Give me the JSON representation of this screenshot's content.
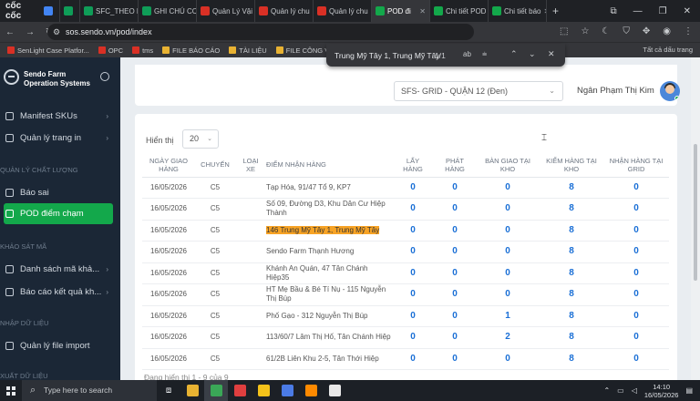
{
  "browser": {
    "brand": "cốc cốc",
    "tabs": [
      {
        "label": "",
        "color": "#4285f4",
        "active": false
      },
      {
        "label": "",
        "color": "#0f9d58",
        "active": false
      },
      {
        "label": "SFC_THEO D",
        "color": "#0f9d58",
        "active": false
      },
      {
        "label": "GHI CHÚ CC",
        "color": "#0f9d58",
        "active": false
      },
      {
        "label": "Quản Lý Vậi",
        "color": "#d93025",
        "active": false
      },
      {
        "label": "Quản lý chu",
        "color": "#d93025",
        "active": false
      },
      {
        "label": "Quản lý chu",
        "color": "#d93025",
        "active": false
      },
      {
        "label": "POD đi",
        "color": "#13a84b",
        "active": true
      },
      {
        "label": "Chi tiết POD",
        "color": "#13a84b",
        "active": false
      },
      {
        "label": "Chi tiết báo",
        "color": "#13a84b",
        "active": false
      }
    ],
    "url": "sos.sendo.vn/pod/index",
    "bookmarks": [
      "SenLight Case Platfor...",
      "OPC",
      "tms",
      "FILE BÁO CÁO",
      "TÀI LIỆU",
      "FILE CÔNG VIỆC"
    ],
    "bookmarks_right": "Tất cả dấu trang"
  },
  "find": {
    "query": "Trung Mỹ Tây 1, Trung Mỹ Tây",
    "count": "1/1",
    "ab": "ab"
  },
  "sidebar": {
    "title_line1": "Sendo Farm",
    "title_line2": "Operation Systems",
    "items": [
      {
        "label": "Manifest SKUs",
        "chev": "›"
      },
      {
        "label": "Quản lý trang in",
        "chev": "›"
      },
      {
        "label": "Báo sai",
        "chev": ""
      },
      {
        "label": "POD điểm chạm",
        "chev": ""
      },
      {
        "label": "Danh sách mã khả...",
        "chev": "›"
      },
      {
        "label": "Báo cáo kết quả kh...",
        "chev": "›"
      },
      {
        "label": "Quản lý file import",
        "chev": ""
      }
    ],
    "sections": [
      "QUẢN LÝ CHẤT LƯỢNG",
      "KHẢO SÁT MÃ",
      "NHẬP DỮ LIỆU",
      "XUẤT DỮ LIỆU"
    ]
  },
  "header": {
    "grid_select": "SFS- GRID - QUẬN 12 (Đen)",
    "user_name": "Ngân Phạm Thị Kim"
  },
  "table": {
    "show_label": "Hiển thị",
    "page_size": "20",
    "columns": [
      [
        "NGÀY GIAO",
        "HÀNG"
      ],
      [
        "CHUYẾN",
        ""
      ],
      [
        "LOẠI",
        "XE"
      ],
      [
        "ĐIỂM NHẬN HÀNG",
        ""
      ],
      [
        "LẤY",
        "HÀNG"
      ],
      [
        "PHÁT",
        "HÀNG"
      ],
      [
        "BÀN GIAO TẠI",
        "KHO"
      ],
      [
        "KIỂM HÀNG TẠI",
        "KHO"
      ],
      [
        "NHẬN HÀNG TẠI",
        "GRID"
      ]
    ],
    "rows": [
      {
        "date": "16/05/2026",
        "trip": "C5",
        "type": "",
        "place": "Tạp Hóa, 91/47 Tổ 9, KP7",
        "highlight": "",
        "pick": "0",
        "deliver": "0",
        "handover": "0",
        "check": "8",
        "receive": "0"
      },
      {
        "date": "16/05/2026",
        "trip": "C5",
        "type": "",
        "place": "Số 09, Đường D3, Khu Dân Cư Hiệp Thành",
        "highlight": "",
        "pick": "0",
        "deliver": "0",
        "handover": "0",
        "check": "8",
        "receive": "0"
      },
      {
        "date": "16/05/2026",
        "trip": "C5",
        "type": "",
        "place": "146 ",
        "highlight": "Trung Mỹ Tây 1, Trung Mỹ Tây",
        "pick": "0",
        "deliver": "0",
        "handover": "0",
        "check": "8",
        "receive": "0"
      },
      {
        "date": "16/05/2026",
        "trip": "C5",
        "type": "",
        "place": "Sendo Farm Thạnh Hương",
        "highlight": "",
        "pick": "0",
        "deliver": "0",
        "handover": "0",
        "check": "8",
        "receive": "0"
      },
      {
        "date": "16/05/2026",
        "trip": "C5",
        "type": "",
        "place": "Khánh An Quán, 47 Tân Chánh Hiệp35",
        "highlight": "",
        "pick": "0",
        "deliver": "0",
        "handover": "0",
        "check": "8",
        "receive": "0"
      },
      {
        "date": "16/05/2026",
        "trip": "C5",
        "type": "",
        "place": "HT Mẹ Bầu & Bé Tí Nụ - 115 Nguyễn Thị Búp",
        "highlight": "",
        "pick": "0",
        "deliver": "0",
        "handover": "0",
        "check": "8",
        "receive": "0"
      },
      {
        "date": "16/05/2026",
        "trip": "C5",
        "type": "",
        "place": "Phố Gạo - 312 Nguyễn Thị Búp",
        "highlight": "",
        "pick": "0",
        "deliver": "0",
        "handover": "1",
        "check": "8",
        "receive": "0"
      },
      {
        "date": "16/05/2026",
        "trip": "C5",
        "type": "",
        "place": "113/60/7 Lâm Thị Hố, Tân Chánh Hiệp",
        "highlight": "",
        "pick": "0",
        "deliver": "0",
        "handover": "2",
        "check": "8",
        "receive": "0"
      },
      {
        "date": "16/05/2026",
        "trip": "C5",
        "type": "",
        "place": "61/2B Liên Khu 2-5, Tân Thới Hiệp",
        "highlight": "",
        "pick": "0",
        "deliver": "0",
        "handover": "0",
        "check": "8",
        "receive": "0"
      }
    ],
    "footer": "Đang hiển thị 1 - 9 của 9"
  },
  "taskbar": {
    "search_placeholder": "Type here to search",
    "time": "14:10",
    "date": "16/05/2026",
    "app_colors": [
      "#e8b232",
      "#3aa757",
      "#e03f3f",
      "#f4c21a",
      "#4b7be6",
      "#ff8a00",
      "#e8e8e8"
    ]
  }
}
